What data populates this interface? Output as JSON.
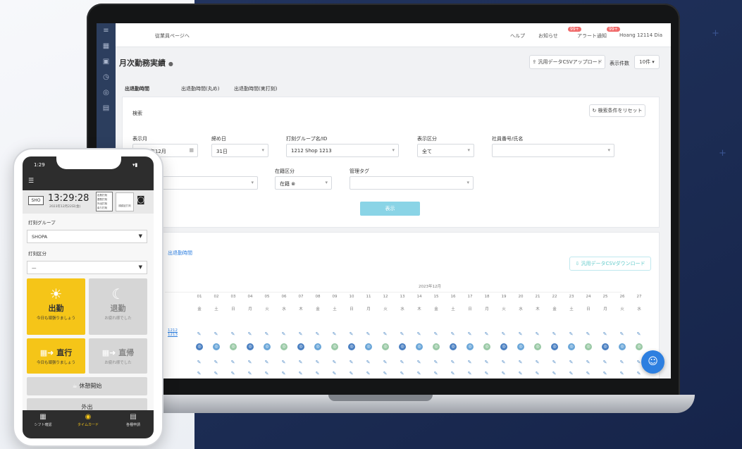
{
  "topbar": {
    "back_link": "従業員ページへ",
    "help": "ヘルプ",
    "notice": "お知らせ",
    "notice_badge": "99+",
    "alert": "アラート通知",
    "alert_badge": "99+",
    "user": "Hoang 12114 Dia"
  },
  "page": {
    "title": "月次勤務実績",
    "csv_upload": "汎用データCSVアップロード",
    "display_count_label": "表示件数",
    "display_count_value": "10件"
  },
  "tabs": [
    "出退勤時間",
    "出退勤時間(丸め)",
    "出退勤時間(実打刻)"
  ],
  "filter": {
    "title": "検索",
    "reset": "検索条件をリセット",
    "month_label": "表示月",
    "month_value": "2023年12月",
    "closing_label": "締め日",
    "closing_value": "31日",
    "group_label": "打刻グループ名/ID",
    "group_value": "1212 Shop 1213",
    "display_label": "表示区分",
    "display_value": "全て",
    "employee_label": "社員番号/氏名",
    "status_label": "在籍区分",
    "status_value": "在籍",
    "tag_label": "管理タグ",
    "search_button": "表示"
  },
  "table": {
    "title": "出退勤時間",
    "csv_download": "汎用データCSVダウンロード",
    "month_header": "2023年12月",
    "days": [
      "01",
      "02",
      "03",
      "04",
      "05",
      "06",
      "07",
      "08",
      "09",
      "10",
      "11",
      "12",
      "13",
      "14",
      "15",
      "16",
      "17",
      "18",
      "19",
      "20",
      "21",
      "22",
      "23",
      "24",
      "25",
      "26",
      "27"
    ],
    "weekdays": [
      "金",
      "土",
      "日",
      "月",
      "火",
      "水",
      "木",
      "金",
      "土",
      "日",
      "月",
      "火",
      "水",
      "木",
      "金",
      "土",
      "日",
      "月",
      "火",
      "水",
      "木",
      "金",
      "土",
      "日",
      "月",
      "火",
      "水"
    ],
    "row_link": "1212 1213"
  },
  "phone": {
    "time_status": "1:29",
    "shop_code": "SHO",
    "clock": "13:29:28",
    "date": "2023年12月22日(金)",
    "tag_box": [
      "出勤打刻",
      "退勤打刻",
      "外出打刻",
      "戻り打刻"
    ],
    "face_btn": "顔認証打刻",
    "group_label": "打刻グループ",
    "group_value": "SHOPA",
    "type_label": "打刻区分",
    "type_value": "—",
    "tiles": [
      {
        "label": "出勤",
        "sub": "今日も頑張りましょう"
      },
      {
        "label": "退勤",
        "sub": "お疲れ様でした"
      },
      {
        "label": "直行",
        "sub": "今日も頑張りましょう"
      },
      {
        "label": "直帰",
        "sub": "お疲れ様でした"
      }
    ],
    "break_start": "休憩開始",
    "out": "外出",
    "nav": [
      "シフト確認",
      "タイムカード",
      "各種申請"
    ]
  },
  "colors": {
    "accent_yellow": "#f5c518",
    "sidebar": "#2c3e5e",
    "background_navy": "#1b2b52",
    "chat": "#2d7fe0"
  }
}
